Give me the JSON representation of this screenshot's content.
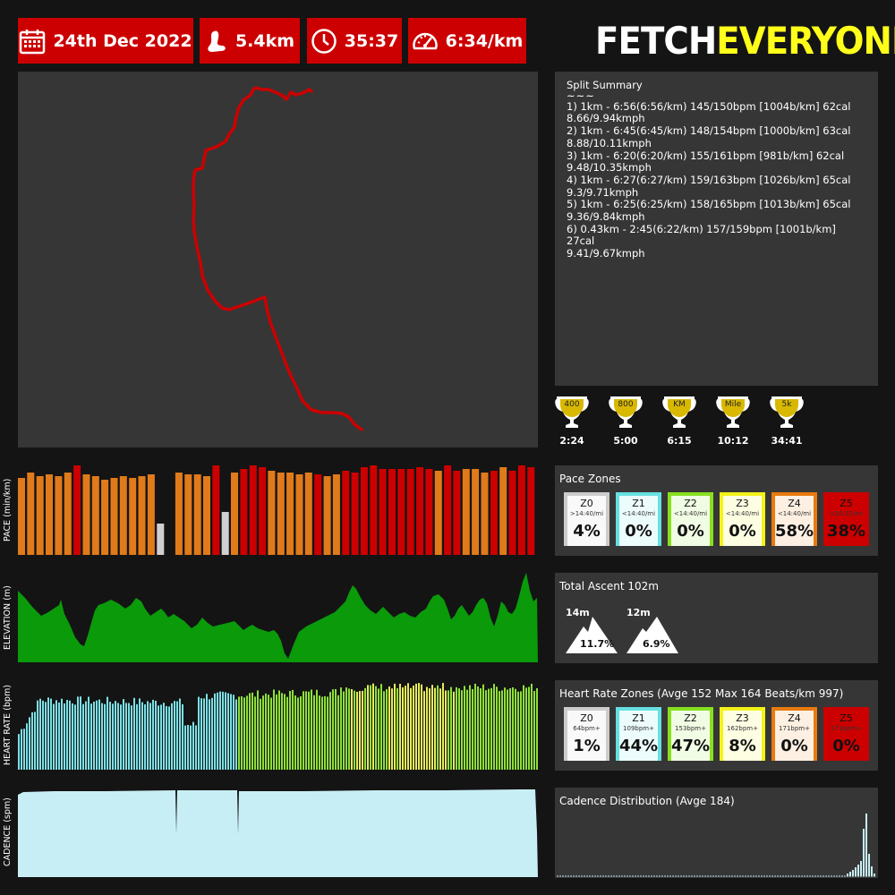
{
  "header": {
    "date": "24th Dec 2022",
    "distance": "5.4km",
    "duration": "35:37",
    "pace": "6:34/km",
    "logo_part1": "FETCH",
    "logo_part2": "EVERYONE",
    "icons": [
      "calendar-icon",
      "footprint-icon",
      "clock-icon",
      "speedometer-icon"
    ],
    "colors": {
      "chip": "#cc0000",
      "logo_accent": "#ffff1a"
    }
  },
  "map": {
    "route_color": "#cc0000"
  },
  "splits": {
    "title": "Split Summary",
    "separator": "~~~",
    "lines": [
      "1) 1km - 6:56(6:56/km) 145/150bpm [1004b/km] 62cal",
      "8.66/9.94kmph",
      "2) 1km - 6:45(6:45/km) 148/154bpm [1000b/km] 63cal",
      "8.88/10.11kmph",
      "3) 1km - 6:20(6:20/km) 155/161bpm [981b/km] 62cal",
      "9.48/10.35kmph",
      "4) 1km - 6:27(6:27/km) 159/163bpm [1026b/km] 65cal",
      "9.3/9.71kmph",
      "5) 1km - 6:25(6:25/km) 158/165bpm [1013b/km] 65cal",
      "9.36/9.84kmph",
      "6) 0.43km - 2:45(6:22/km) 157/159bpm [1001b/km] 27cal",
      "9.41/9.67kmph"
    ]
  },
  "trophies": [
    {
      "badge": "400",
      "time": "2:24"
    },
    {
      "badge": "800",
      "time": "5:00"
    },
    {
      "badge": "KM",
      "time": "6:15"
    },
    {
      "badge": "Mile",
      "time": "10:12"
    },
    {
      "badge": "5k",
      "time": "34:41"
    }
  ],
  "graphs": {
    "pace_label": "PACE (min/km)",
    "elevation_label": "ELEVATION (m)",
    "hr_label": "HEART RATE (bpm)",
    "cadence_label": "CADENCE (spm)"
  },
  "pace_zones": {
    "title": "Pace Zones",
    "zones": [
      {
        "name": "Z0",
        "sub": ">14:40/mi",
        "pct": "4%",
        "color": "#cccccc"
      },
      {
        "name": "Z1",
        "sub": "<14:40/mi",
        "pct": "0%",
        "color": "#66e0e0"
      },
      {
        "name": "Z2",
        "sub": "<14:40/mi",
        "pct": "0%",
        "color": "#88e020"
      },
      {
        "name": "Z3",
        "sub": "<14:40/mi",
        "pct": "0%",
        "color": "#f2f21a"
      },
      {
        "name": "Z4",
        "sub": "<14:40/mi",
        "pct": "58%",
        "color": "#e87a10"
      },
      {
        "name": "Z5",
        "sub": "<10:31/mi",
        "pct": "38%",
        "color": "#cc0000"
      }
    ]
  },
  "ascent": {
    "title": "Total Ascent 102m",
    "peaks": [
      {
        "height": "14m",
        "grade": "11.7%"
      },
      {
        "height": "12m",
        "grade": "6.9%"
      }
    ]
  },
  "hr_zones": {
    "title": "Heart Rate Zones (Avge 152 Max 164 Beats/km 997)",
    "zones": [
      {
        "name": "Z0",
        "sub": "64bpm+",
        "pct": "1%",
        "color": "#cccccc"
      },
      {
        "name": "Z1",
        "sub": "109bpm+",
        "pct": "44%",
        "color": "#66e0e0"
      },
      {
        "name": "Z2",
        "sub": "153bpm+",
        "pct": "47%",
        "color": "#88e020"
      },
      {
        "name": "Z3",
        "sub": "162bpm+",
        "pct": "8%",
        "color": "#f2f21a"
      },
      {
        "name": "Z4",
        "sub": "171bpm+",
        "pct": "0%",
        "color": "#e87a10"
      },
      {
        "name": "Z5",
        "sub": "171bpm+",
        "pct": "0%",
        "color": "#cc0000"
      }
    ]
  },
  "cadence": {
    "title": "Cadence Distribution (Avge 184)"
  }
}
